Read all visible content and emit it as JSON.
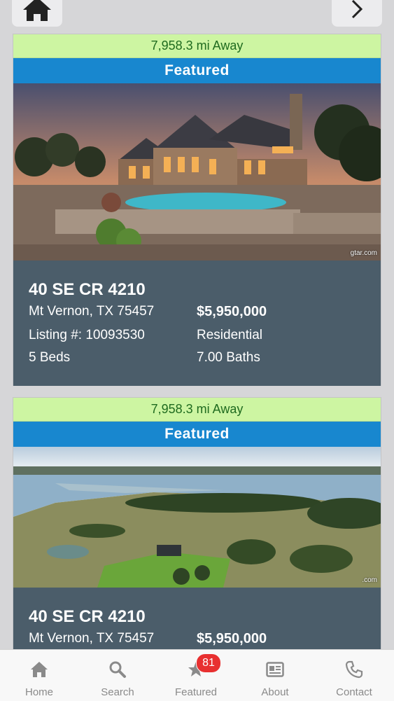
{
  "topbar": {
    "home_icon": "home-icon",
    "next_icon": "chevron-right-icon"
  },
  "listings": [
    {
      "distance": "7,958.3 mi Away",
      "badge": "Featured",
      "watermark": "gtar.com",
      "address": "40 SE CR 4210",
      "city": "Mt Vernon, TX 75457",
      "price": "$5,950,000",
      "listing_number": "Listing #: 10093530",
      "type": "Residential",
      "beds": "5 Beds",
      "baths": "7.00 Baths"
    },
    {
      "distance": "7,958.3 mi Away",
      "badge": "Featured",
      "watermark": ".com",
      "address": "40 SE CR 4210",
      "city": "Mt Vernon, TX 75457",
      "price": "$5,950,000"
    }
  ],
  "tabbar": {
    "tabs": [
      {
        "label": "Home",
        "icon": "home-icon"
      },
      {
        "label": "Search",
        "icon": "search-icon"
      },
      {
        "label": "Featured",
        "icon": "star-icon",
        "badge": "81"
      },
      {
        "label": "About",
        "icon": "id-card-icon"
      },
      {
        "label": "Contact",
        "icon": "phone-icon"
      }
    ]
  },
  "colors": {
    "distance_bg": "#cdf5a2",
    "featured_bg": "#1887cf",
    "info_bg": "#4b5d6a",
    "badge_red": "#e83030"
  }
}
